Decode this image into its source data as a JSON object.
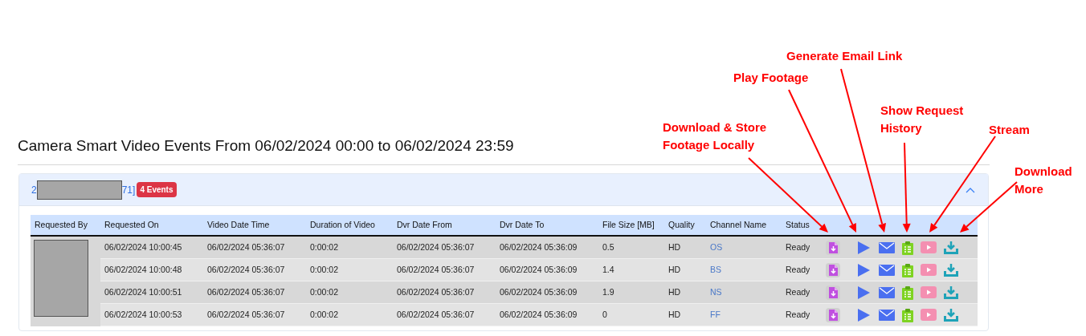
{
  "title": "Camera Smart Video Events From 06/02/2024 00:00 to 06/02/2024 23:59",
  "group": {
    "id_start": "2",
    "id_end": "71]",
    "badge": "4 Events",
    "expanded": true
  },
  "table": {
    "columns": [
      "Requested By",
      "Requested On",
      "Video Date Time",
      "Duration of Video",
      "Dvr Date From",
      "Dvr Date To",
      "File Size [MB]",
      "Quality",
      "Channel Name",
      "Status"
    ],
    "rows": [
      {
        "requested_on": "06/02/2024 10:00:45",
        "video_date_time": "06/02/2024 05:36:07",
        "duration": "0:00:02",
        "dvr_from": "06/02/2024 05:36:07",
        "dvr_to": "06/02/2024 05:36:09",
        "file_size": "0.5",
        "quality": "HD",
        "channel": "OS",
        "status": "Ready"
      },
      {
        "requested_on": "06/02/2024 10:00:48",
        "video_date_time": "06/02/2024 05:36:07",
        "duration": "0:00:02",
        "dvr_from": "06/02/2024 05:36:07",
        "dvr_to": "06/02/2024 05:36:09",
        "file_size": "1.4",
        "quality": "HD",
        "channel": "BS",
        "status": "Ready"
      },
      {
        "requested_on": "06/02/2024 10:00:51",
        "video_date_time": "06/02/2024 05:36:07",
        "duration": "0:00:02",
        "dvr_from": "06/02/2024 05:36:07",
        "dvr_to": "06/02/2024 05:36:09",
        "file_size": "1.9",
        "quality": "HD",
        "channel": "NS",
        "status": "Ready"
      },
      {
        "requested_on": "06/02/2024 10:00:53",
        "video_date_time": "06/02/2024 05:36:07",
        "duration": "0:00:02",
        "dvr_from": "06/02/2024 05:36:07",
        "dvr_to": "06/02/2024 05:36:09",
        "file_size": "0",
        "quality": "HD",
        "channel": "FF",
        "status": "Ready"
      }
    ]
  },
  "annotations": [
    {
      "text": "Download & Store Footage Locally"
    },
    {
      "text": "Play Footage"
    },
    {
      "text": "Generate Email Link"
    },
    {
      "text": "Show Request History"
    },
    {
      "text": "Stream"
    },
    {
      "text": "Download More"
    }
  ]
}
